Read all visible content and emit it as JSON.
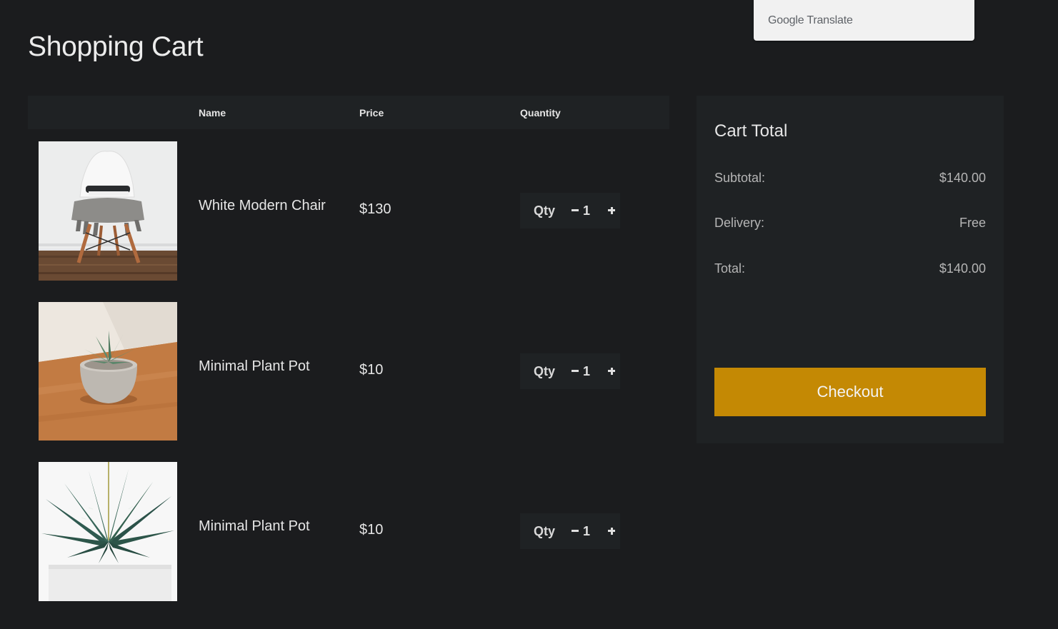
{
  "page": {
    "title": "Shopping Cart"
  },
  "translate_widget": {
    "brand": "Google",
    "label": "Translate"
  },
  "table": {
    "columns": [
      "Name",
      "Price",
      "Quantity"
    ],
    "rows": [
      {
        "name": "White Modern Chair",
        "price": "$130",
        "qty_label": "Qty",
        "qty": "1",
        "image": "chair-photo"
      },
      {
        "name": "Minimal Plant Pot",
        "price": "$10",
        "qty_label": "Qty",
        "qty": "1",
        "image": "plant-pot-photo"
      },
      {
        "name": "Minimal Plant Pot",
        "price": "$10",
        "qty_label": "Qty",
        "qty": "1",
        "image": "succulent-photo"
      }
    ]
  },
  "summary": {
    "title": "Cart Total",
    "subtotal_label": "Subtotal:",
    "subtotal_value": "$140.00",
    "delivery_label": "Delivery:",
    "delivery_value": "Free",
    "total_label": "Total:",
    "total_value": "$140.00",
    "checkout_label": "Checkout"
  },
  "colors": {
    "background": "#1b1c1e",
    "panel": "#1f2224",
    "accent": "#c48904"
  }
}
